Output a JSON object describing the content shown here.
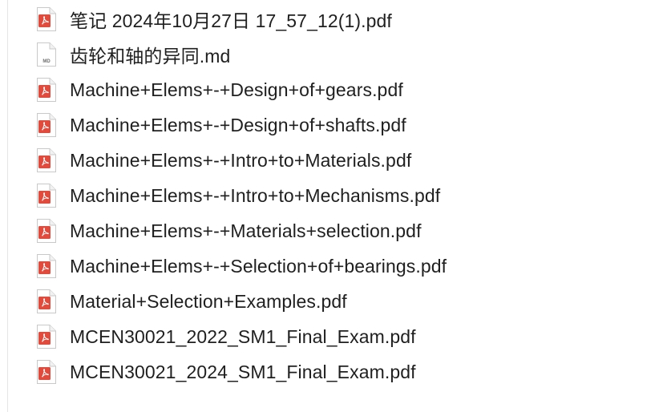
{
  "files": [
    {
      "name": "笔记 2024年10月27日 17_57_12(1).pdf",
      "type": "pdf",
      "icon": "pdf-file-icon"
    },
    {
      "name": "齿轮和轴的异同.md",
      "type": "md",
      "icon": "markdown-file-icon",
      "badge": "MD"
    },
    {
      "name": "Machine+Elems+-+Design+of+gears.pdf",
      "type": "pdf",
      "icon": "pdf-file-icon"
    },
    {
      "name": "Machine+Elems+-+Design+of+shafts.pdf",
      "type": "pdf",
      "icon": "pdf-file-icon"
    },
    {
      "name": "Machine+Elems+-+Intro+to+Materials.pdf",
      "type": "pdf",
      "icon": "pdf-file-icon"
    },
    {
      "name": "Machine+Elems+-+Intro+to+Mechanisms.pdf",
      "type": "pdf",
      "icon": "pdf-file-icon"
    },
    {
      "name": "Machine+Elems+-+Materials+selection.pdf",
      "type": "pdf",
      "icon": "pdf-file-icon"
    },
    {
      "name": "Machine+Elems+-+Selection+of+bearings.pdf",
      "type": "pdf",
      "icon": "pdf-file-icon"
    },
    {
      "name": "Material+Selection+Examples.pdf",
      "type": "pdf",
      "icon": "pdf-file-icon"
    },
    {
      "name": "MCEN30021_2022_SM1_Final_Exam.pdf",
      "type": "pdf",
      "icon": "pdf-file-icon"
    },
    {
      "name": "MCEN30021_2024_SM1_Final_Exam.pdf",
      "type": "pdf",
      "icon": "pdf-file-icon"
    }
  ],
  "colors": {
    "pdf_accent": "#e14b3e",
    "text": "#1f1f1f",
    "page_border": "#c9c9c9"
  }
}
